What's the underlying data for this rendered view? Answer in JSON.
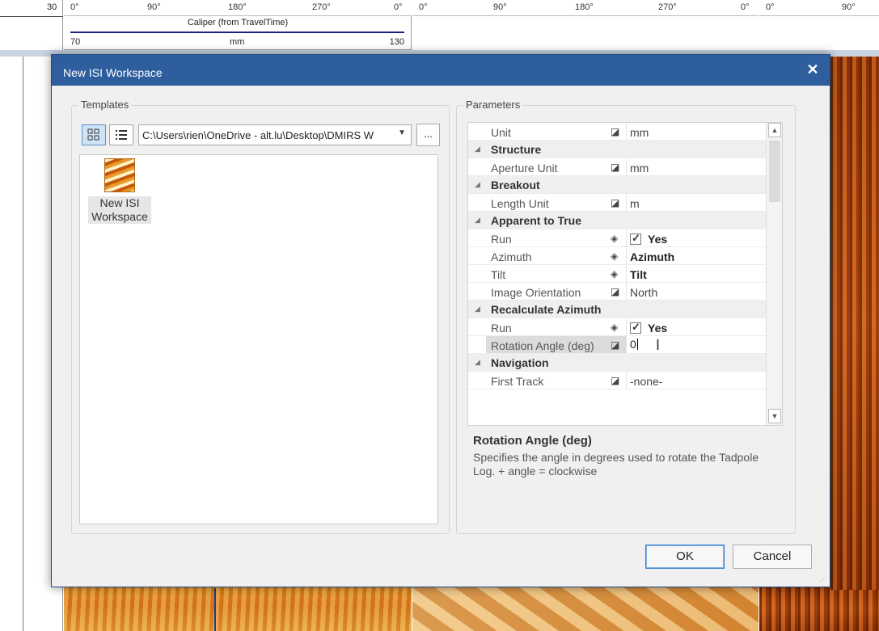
{
  "background": {
    "depth_tick": "30",
    "track1_ticks": [
      "0°",
      "90°",
      "180°",
      "270°",
      "0°"
    ],
    "track2_ticks": [
      "0°",
      "90°",
      "180°",
      "270°",
      "0°"
    ],
    "track3_ticks": [
      "0°",
      "90°"
    ],
    "caliper_title": "Caliper (from TravelTime)",
    "caliper_min": "70",
    "caliper_unit": "mm",
    "caliper_max": "130"
  },
  "dialog": {
    "title": "New ISI Workspace",
    "close_glyph": "✕",
    "templates": {
      "label": "Templates",
      "path": "C:\\Users\\rien\\OneDrive - alt.lu\\Desktop\\DMIRS W",
      "browse_label": "...",
      "items": [
        {
          "label": "New ISI Workspace"
        }
      ]
    },
    "parameters": {
      "label": "Parameters",
      "rows": [
        {
          "type": "prop",
          "name": "Unit",
          "value": "mm"
        },
        {
          "type": "cat",
          "name": "Structure"
        },
        {
          "type": "prop",
          "name": "Aperture Unit",
          "value": "mm"
        },
        {
          "type": "cat",
          "name": "Breakout"
        },
        {
          "type": "prop",
          "name": "Length Unit",
          "value": "m"
        },
        {
          "type": "cat",
          "name": "Apparent to True"
        },
        {
          "type": "prop",
          "name": "Run",
          "value": "Yes",
          "checked": true
        },
        {
          "type": "prop",
          "name": "Azimuth",
          "value": "Azimuth"
        },
        {
          "type": "prop",
          "name": "Tilt",
          "value": "Tilt"
        },
        {
          "type": "prop",
          "name": "Image Orientation",
          "value": "North"
        },
        {
          "type": "cat",
          "name": "Recalculate Azimuth"
        },
        {
          "type": "prop",
          "name": "Run",
          "value": "Yes",
          "checked": true
        },
        {
          "type": "prop",
          "name": "Rotation Angle (deg)",
          "value": "0",
          "editing": true
        },
        {
          "type": "cat",
          "name": "Navigation"
        },
        {
          "type": "prop",
          "name": "First Track",
          "value": "-none-"
        }
      ],
      "description_title": "Rotation Angle (deg)",
      "description_text": "Specifies the angle in degrees used to rotate the Tadpole Log. + angle = clockwise"
    },
    "ok_label": "OK",
    "cancel_label": "Cancel"
  }
}
